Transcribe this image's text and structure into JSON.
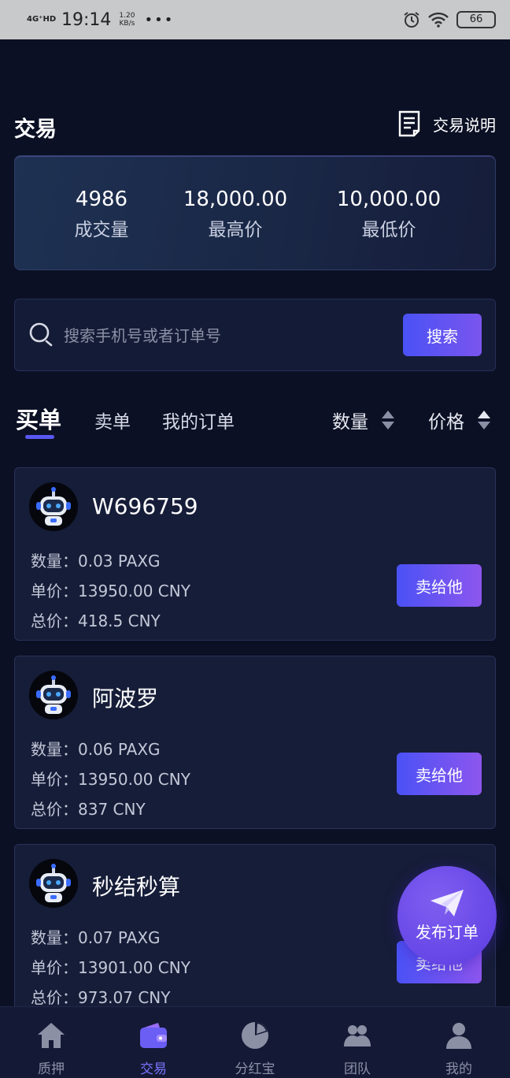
{
  "status_bar": {
    "network": "4G⁺HD",
    "time": "19:14",
    "speed_value": "1.20",
    "speed_unit": "KB/s",
    "dots": "•••",
    "battery": "66"
  },
  "header": {
    "title": "交易",
    "help_label": "交易说明"
  },
  "stats": [
    {
      "value": "4986",
      "label": "成交量"
    },
    {
      "value": "18,000.00",
      "label": "最高价"
    },
    {
      "value": "10,000.00",
      "label": "最低价"
    }
  ],
  "search": {
    "placeholder": "搜索手机号或者订单号",
    "button_label": "搜索"
  },
  "tabs": [
    {
      "label": "买单",
      "active": true
    },
    {
      "label": "卖单",
      "active": false
    },
    {
      "label": "我的订单",
      "active": false
    }
  ],
  "sort": {
    "quantity_label": "数量",
    "price_label": "价格"
  },
  "orders": [
    {
      "name": "W696759",
      "quantity": "数量：0.03 PAXG",
      "unit_price": "单价：13950.00 CNY",
      "total": "总价：418.5 CNY",
      "action": "卖给他"
    },
    {
      "name": "阿波罗",
      "quantity": "数量：0.06 PAXG",
      "unit_price": "单价：13950.00 CNY",
      "total": "总价：837 CNY",
      "action": "卖给他"
    },
    {
      "name": "秒结秒算",
      "quantity": "数量：0.07 PAXG",
      "unit_price": "单价：13901.00 CNY",
      "total": "总价：973.07 CNY",
      "action": "卖给他"
    }
  ],
  "publish_button": {
    "label": "发布订单"
  },
  "bottom_nav": [
    {
      "label": "质押",
      "icon": "home-icon",
      "active": false
    },
    {
      "label": "交易",
      "icon": "wallet-icon",
      "active": true
    },
    {
      "label": "分红宝",
      "icon": "pie-chart-icon",
      "active": false
    },
    {
      "label": "团队",
      "icon": "team-icon",
      "active": false
    },
    {
      "label": "我的",
      "icon": "user-icon",
      "active": false
    }
  ],
  "colors": {
    "background": "#0b1024",
    "accent": "#5a58f2",
    "card": "#161d38",
    "nav_active": "#7a74ff"
  }
}
